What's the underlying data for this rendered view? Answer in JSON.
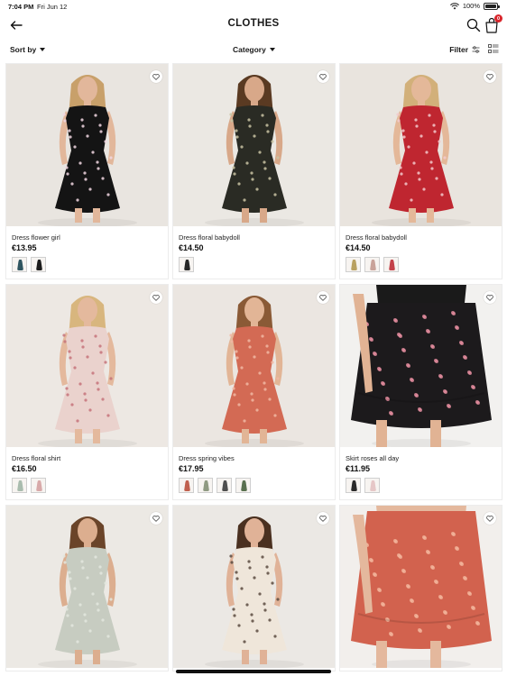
{
  "status_bar": {
    "time": "7:04 PM",
    "date": "Fri Jun 12",
    "battery": "100%"
  },
  "header": {
    "title": "CLOTHES",
    "cart_count": "0"
  },
  "filters": {
    "sort_label": "Sort by",
    "category_label": "Category",
    "filter_label": "Filter"
  },
  "colors": {
    "accent": "#d9262c",
    "text": "#1a1a1a"
  },
  "products": [
    {
      "name": "Dress flower girl",
      "price": "€13.95",
      "swatches": [
        "#2f5560",
        "#1b1b1b"
      ],
      "photo": {
        "bg": "#e9e5e0",
        "garment": "#141414",
        "pattern": "#f1d7e2",
        "skin": "#e2b79b",
        "hair": "#c8a06a"
      }
    },
    {
      "name": "Dress floral babydoll",
      "price": "€14.50",
      "swatches": [
        "#262626"
      ],
      "photo": {
        "bg": "#ebe8e3",
        "garment": "#2a2b24",
        "pattern": "#c9c3a3",
        "skin": "#d8a889",
        "hair": "#5a3a22"
      }
    },
    {
      "name": "Dress floral babydoll",
      "price": "€14.50",
      "swatches": [
        "#b9a161",
        "#c9a39a",
        "#c4424a"
      ],
      "photo": {
        "bg": "#e9e4de",
        "garment": "#bf2630",
        "pattern": "#f2c9cb",
        "skin": "#e4b899",
        "hair": "#d2b07a"
      }
    },
    {
      "name": "Dress floral shirt",
      "price": "€16.50",
      "swatches": [
        "#a9bcae",
        "#d8a9a9"
      ],
      "photo": {
        "bg": "#ede8e3",
        "garment": "#ead2cd",
        "pattern": "#c5737a",
        "skin": "#e4b99d",
        "hair": "#d8b67e"
      }
    },
    {
      "name": "Dress spring vibes",
      "price": "€17.95",
      "swatches": [
        "#c0604e",
        "#8f9a82",
        "#4e4e4e",
        "#59704f"
      ],
      "photo": {
        "bg": "#ebe6e1",
        "garment": "#d36a54",
        "pattern": "#f0b7a3",
        "skin": "#e2b596",
        "hair": "#8a5a36"
      }
    },
    {
      "name": "Skirt roses all day",
      "price": "€11.95",
      "swatches": [
        "#2a2a2a",
        "#e6c7c7"
      ],
      "photo": {
        "bg": "#f2f1ef",
        "garment": "#1c1a1c",
        "pattern": "#e58d9f",
        "skin": "#e1b394",
        "hair": "#2b2b2b"
      }
    },
    {
      "name": "",
      "price": "",
      "swatches": [],
      "photo": {
        "bg": "#ece9e4",
        "garment": "#c7ccc1",
        "pattern": "#e3e6de",
        "skin": "#dcae8f",
        "hair": "#6a4429"
      }
    },
    {
      "name": "",
      "price": "",
      "swatches": [],
      "photo": {
        "bg": "#ebe8e4",
        "garment": "#efe6da",
        "pattern": "#5a4a40",
        "skin": "#e0b297",
        "hair": "#4a3020"
      }
    },
    {
      "name": "",
      "price": "",
      "swatches": [],
      "photo": {
        "bg": "#f2efec",
        "garment": "#d2624e",
        "pattern": "#f3b49b",
        "skin": "#e4b89d",
        "hair": "#2b2b2b"
      }
    }
  ]
}
